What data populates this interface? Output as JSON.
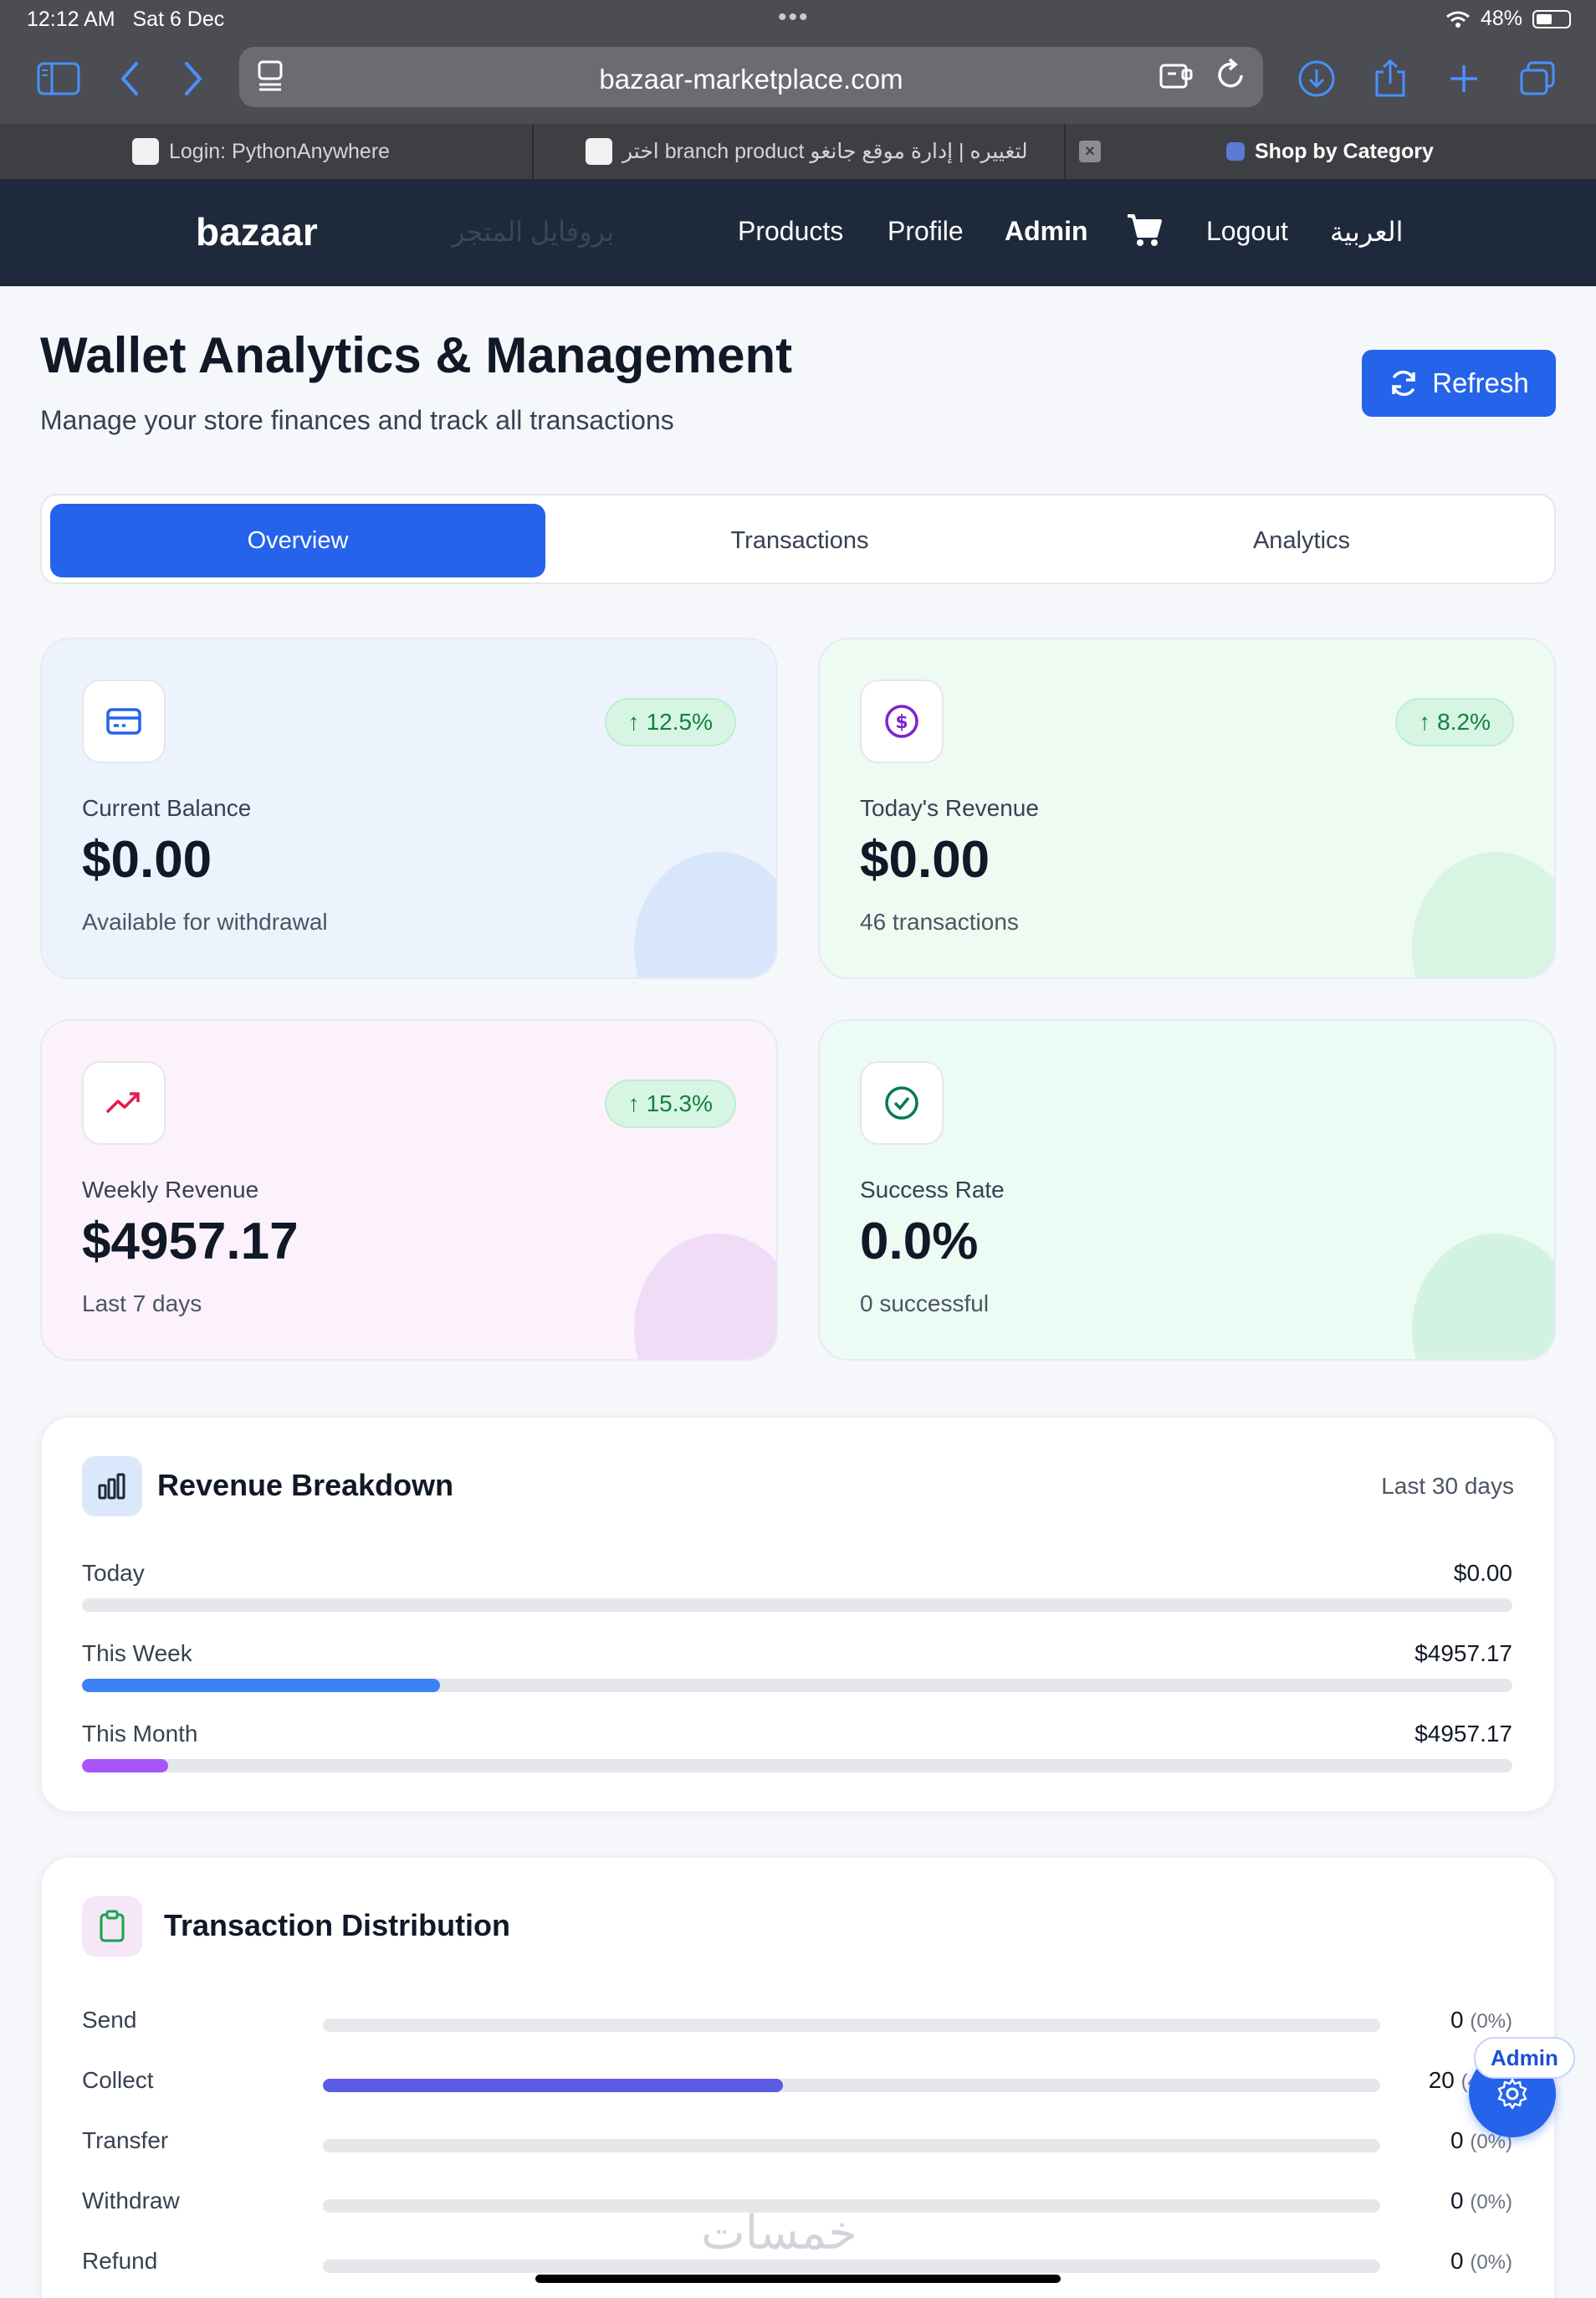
{
  "status": {
    "time": "12:12 AM",
    "date": "Sat 6 Dec",
    "battery": "48%"
  },
  "browser": {
    "url": "bazaar-marketplace.com",
    "tabs": [
      {
        "label": "Login: PythonAnywhere"
      },
      {
        "label": "اختر branch product لتغييره | إدارة موقع جانغو"
      },
      {
        "label": "Shop by Category"
      }
    ]
  },
  "nav": {
    "brand": "bazaar",
    "ghost": "بروفايل المتجر",
    "links": [
      "Products",
      "Profile",
      "Admin",
      "Logout",
      "العربية"
    ]
  },
  "header": {
    "title": "Wallet Analytics & Management",
    "subtitle": "Manage your store finances and track all transactions",
    "refresh_label": "Refresh"
  },
  "tabs": [
    "Overview",
    "Transactions",
    "Analytics"
  ],
  "cards": [
    {
      "label": "Current Balance",
      "value": "$0.00",
      "sub": "Available for withdrawal",
      "badge": "12.5%"
    },
    {
      "label": "Today's Revenue",
      "value": "$0.00",
      "sub": "46 transactions",
      "badge": "8.2%"
    },
    {
      "label": "Weekly Revenue",
      "value": "$4957.17",
      "sub": "Last 7 days",
      "badge": "15.3%"
    },
    {
      "label": "Success Rate",
      "value": "0.0%",
      "sub": "0 successful"
    }
  ],
  "revenue_breakdown": {
    "title": "Revenue Breakdown",
    "period": "Last 30 days",
    "rows": [
      {
        "label": "Today",
        "value": "$0.00",
        "fill_fraction": 0.0,
        "color": "#3b82f6"
      },
      {
        "label": "This Week",
        "value": "$4957.17",
        "fill_fraction": 0.25,
        "color": "#3b82f6"
      },
      {
        "label": "This Month",
        "value": "$4957.17",
        "fill_fraction": 0.06,
        "color": "#a855f7"
      }
    ]
  },
  "transaction_distribution": {
    "title": "Transaction Distribution",
    "rows": [
      {
        "label": "Send",
        "count": "0",
        "pct": "(0%)",
        "fill_fraction": 0.0
      },
      {
        "label": "Collect",
        "count": "20",
        "pct": "(4",
        "fill_fraction": 0.435
      },
      {
        "label": "Transfer",
        "count": "0",
        "pct": "(0%)",
        "fill_fraction": 0.0
      },
      {
        "label": "Withdraw",
        "count": "0",
        "pct": "(0%)",
        "fill_fraction": 0.0
      },
      {
        "label": "Refund",
        "count": "0",
        "pct": "(0%)",
        "fill_fraction": 0.0
      }
    ]
  },
  "admin_fab": {
    "label": "Admin"
  },
  "watermark": "خمسات",
  "colors": {
    "primary": "#2563eb",
    "nav_bg": "#1e293b",
    "success": "#15803d"
  }
}
